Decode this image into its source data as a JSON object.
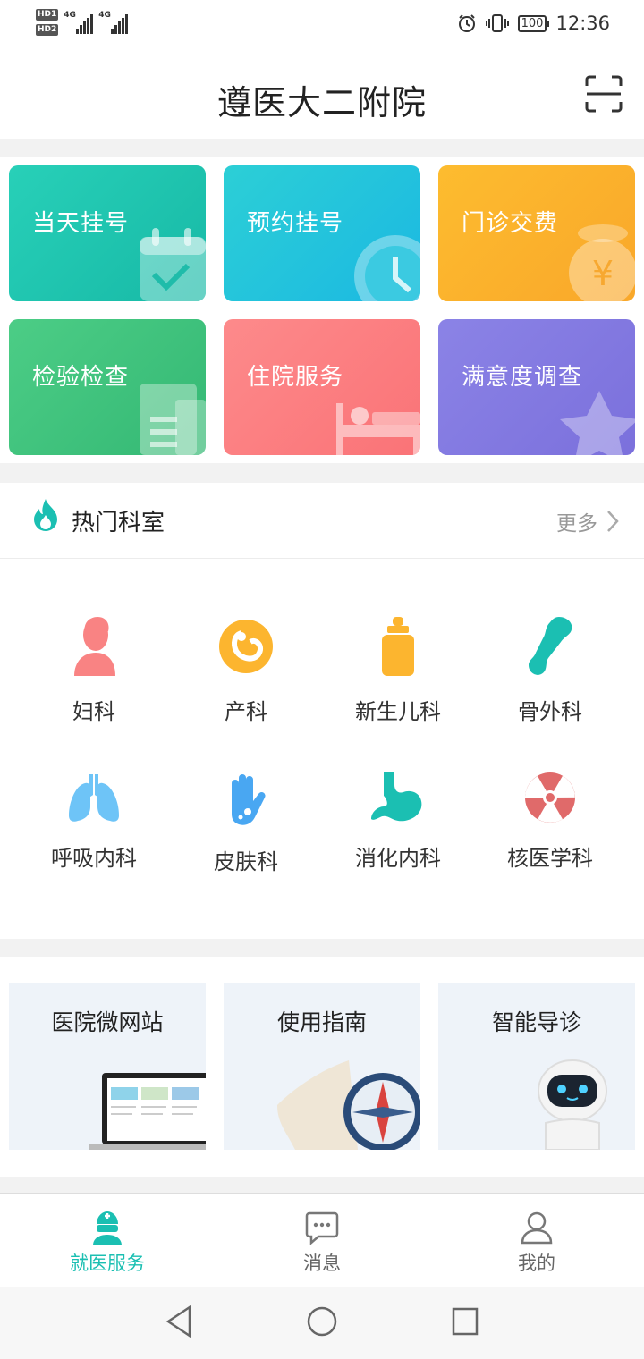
{
  "status": {
    "hd1": "HD1",
    "hd2": "HD2",
    "network1": "4G",
    "network2": "4G",
    "battery": "100",
    "time": "12:36"
  },
  "header": {
    "title": "遵医大二附院",
    "scan_icon": "scan-icon"
  },
  "services": [
    {
      "label": "当天挂号",
      "icon": "calendar-check-icon",
      "color": "#22c9b0"
    },
    {
      "label": "预约挂号",
      "icon": "clock-icon",
      "color": "#27c6dd"
    },
    {
      "label": "门诊交费",
      "icon": "money-bag-icon",
      "color": "#fbb52f"
    },
    {
      "label": "检验检查",
      "icon": "report-icon",
      "color": "#44c47f"
    },
    {
      "label": "住院服务",
      "icon": "bed-icon",
      "color": "#fc7f81"
    },
    {
      "label": "满意度调查",
      "icon": "star-icon",
      "color": "#857be2"
    }
  ],
  "hot_departments": {
    "title": "热门科室",
    "more": "更多",
    "items": [
      {
        "label": "妇科",
        "icon": "female-icon"
      },
      {
        "label": "产科",
        "icon": "fetus-icon"
      },
      {
        "label": "新生儿科",
        "icon": "baby-bottle-icon"
      },
      {
        "label": "骨外科",
        "icon": "bone-icon"
      },
      {
        "label": "呼吸内科",
        "icon": "lungs-icon"
      },
      {
        "label": "皮肤科",
        "icon": "hand-icon"
      },
      {
        "label": "消化内科",
        "icon": "stomach-icon"
      },
      {
        "label": "核医学科",
        "icon": "radiation-icon"
      }
    ]
  },
  "cards": [
    {
      "title": "医院微网站",
      "icon": "laptop-icon"
    },
    {
      "title": "使用指南",
      "icon": "compass-icon"
    },
    {
      "title": "智能导诊",
      "icon": "robot-icon"
    }
  ],
  "tabs": [
    {
      "label": "就医服务",
      "icon": "doctor-icon",
      "active": true
    },
    {
      "label": "消息",
      "icon": "chat-icon",
      "active": false
    },
    {
      "label": "我的",
      "icon": "user-icon",
      "active": false
    }
  ],
  "colors": {
    "accent": "#1bbfb2"
  }
}
